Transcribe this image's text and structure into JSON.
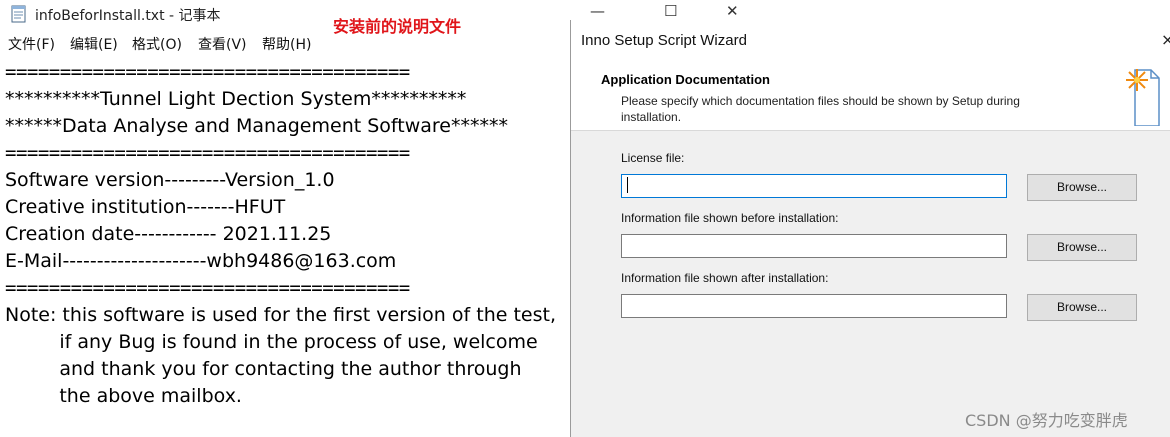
{
  "notepad": {
    "title": "infoBeforInstall.txt - 记事本",
    "annotation": "安装前的说明文件",
    "menu": [
      "文件(F)",
      "编辑(E)",
      "格式(O)",
      "查看(V)",
      "帮助(H)"
    ],
    "lines": [
      "=====================================",
      "**********Tunnel Light Dection System**********",
      "******Data Analyse and Management Software******",
      "=====================================",
      "Software version---------Version_1.0",
      "Creative institution-------HFUT",
      "Creation date------------ 2021.11.25",
      "E-Mail---------------------wbh9486@163.com",
      "=====================================",
      "Note: this software is used for the first version of the test,",
      "         if any Bug is found in the process of use, welcome",
      "         and thank you for contacting the author through",
      "         the above mailbox."
    ]
  },
  "window_controls": {
    "minimize": "—",
    "maximize": "☐",
    "close": "✕"
  },
  "wizard": {
    "title": "Inno Setup Script Wizard",
    "close_glyph": "×",
    "header_title": "Application Documentation",
    "header_desc": "Please specify which documentation files should be shown by Setup during installation.",
    "fields": [
      {
        "label": "License file:",
        "value": "",
        "button": "Browse..."
      },
      {
        "label": "Information file shown before installation:",
        "value": "",
        "button": "Browse..."
      },
      {
        "label": "Information file shown after installation:",
        "value": "",
        "button": "Browse..."
      }
    ]
  },
  "watermark": "CSDN @努力吃变胖虎"
}
